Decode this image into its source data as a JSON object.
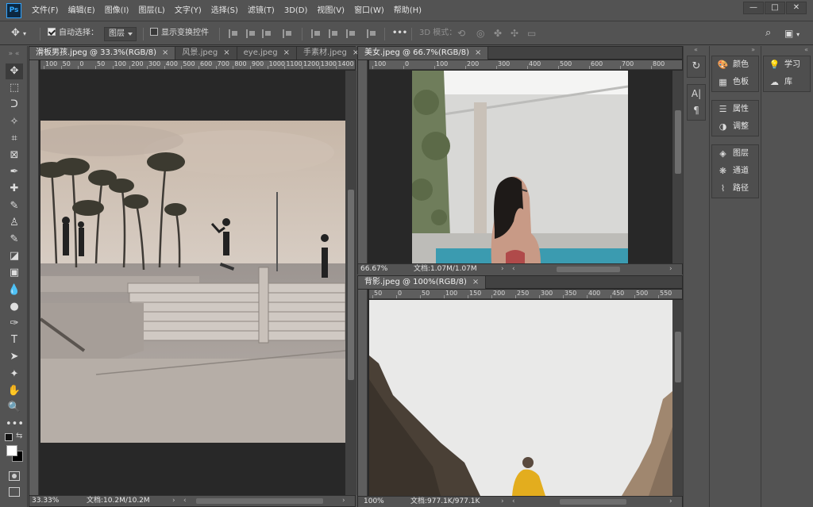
{
  "app": {
    "logo": "Ps"
  },
  "menu": [
    "文件(F)",
    "编辑(E)",
    "图像(I)",
    "图层(L)",
    "文字(Y)",
    "选择(S)",
    "滤镜(T)",
    "3D(D)",
    "视图(V)",
    "窗口(W)",
    "帮助(H)"
  ],
  "window_controls": {
    "minimize": "—",
    "restore": "□",
    "close": "✕"
  },
  "options": {
    "auto_select_label": "自动选择：",
    "auto_select_checked": true,
    "auto_select_target": "图层",
    "show_transform_label": "显示变换控件",
    "show_transform_checked": false,
    "more_label": "•••",
    "mode_3d_label": "3D 模式："
  },
  "tools": [
    "move-tool",
    "marquee-tool",
    "lasso-tool",
    "quick-selection-tool",
    "crop-tool",
    "frame-tool",
    "eyedropper-tool",
    "healing-brush-tool",
    "brush-tool",
    "clone-stamp-tool",
    "history-brush-tool",
    "eraser-tool",
    "gradient-tool",
    "blur-tool",
    "dodge-tool",
    "pen-tool",
    "type-tool",
    "path-selection-tool",
    "custom-shape-tool",
    "hand-tool",
    "zoom-tool",
    "edit-toolbar"
  ],
  "tool_glyphs": [
    "✥",
    "⬚",
    "ᑐ",
    "✧",
    "⌗",
    "⊠",
    "✒",
    "✚",
    "✎",
    "♙",
    "✎",
    "◪",
    "▣",
    "💧",
    "●",
    "✑",
    "T",
    "➤",
    "✦",
    "✋",
    "🔍",
    "•••"
  ],
  "documents": {
    "left": {
      "tabs": [
        {
          "label": "滑板男孩.jpeg @ 33.3%(RGB/8)",
          "active": true
        },
        {
          "label": "风景.jpeg",
          "active": false
        },
        {
          "label": "eye.jpeg",
          "active": false
        },
        {
          "label": "手素材.jpeg",
          "active": false
        }
      ],
      "overflow": "»",
      "ruler": [
        "100",
        "50",
        "0",
        "50",
        "100",
        "200",
        "300",
        "400",
        "500",
        "600",
        "700",
        "800",
        "900",
        "1000",
        "1100",
        "1200",
        "1300",
        "1400"
      ],
      "zoom": "33.33%",
      "doc_size": "文档:10.2M/10.2M"
    },
    "top_right": {
      "tab": "美女.jpeg @ 66.7%(RGB/8)",
      "ruler": [
        "100",
        "0",
        "100",
        "200",
        "300",
        "400",
        "500",
        "600",
        "700",
        "800"
      ],
      "zoom": "66.67%",
      "doc_size": "文档:1.07M/1.07M"
    },
    "bottom_right": {
      "tab": "背影.jpeg @ 100%(RGB/8)",
      "ruler": [
        "50",
        "0",
        "50",
        "100",
        "150",
        "200",
        "250",
        "300",
        "350",
        "400",
        "450",
        "500",
        "550"
      ],
      "zoom": "100%",
      "doc_size": "文档:977.1K/977.1K"
    },
    "close_glyph": "×"
  },
  "panels": {
    "group1": [
      {
        "label": "颜色",
        "icon": "palette-icon",
        "glyph": "🎨"
      },
      {
        "label": "色板",
        "icon": "swatches-icon",
        "glyph": "▦"
      }
    ],
    "group2": [
      {
        "label": "属性",
        "icon": "properties-icon",
        "glyph": "☰"
      },
      {
        "label": "调整",
        "icon": "adjustments-icon",
        "glyph": "◑"
      }
    ],
    "group3": [
      {
        "label": "图层",
        "icon": "layers-icon",
        "glyph": "◈"
      },
      {
        "label": "通道",
        "icon": "channels-icon",
        "glyph": "❋"
      },
      {
        "label": "路径",
        "icon": "paths-icon",
        "glyph": "⌇"
      }
    ],
    "group4": [
      {
        "label": "学习",
        "icon": "lightbulb-icon",
        "glyph": "💡"
      },
      {
        "label": "库",
        "icon": "libraries-icon",
        "glyph": "☁"
      }
    ],
    "strip_glyphs": [
      "↻",
      "A|",
      "¶"
    ]
  },
  "colors": {
    "accent": "#31a8ff",
    "bg": "#535353",
    "canvas": "#282828"
  }
}
